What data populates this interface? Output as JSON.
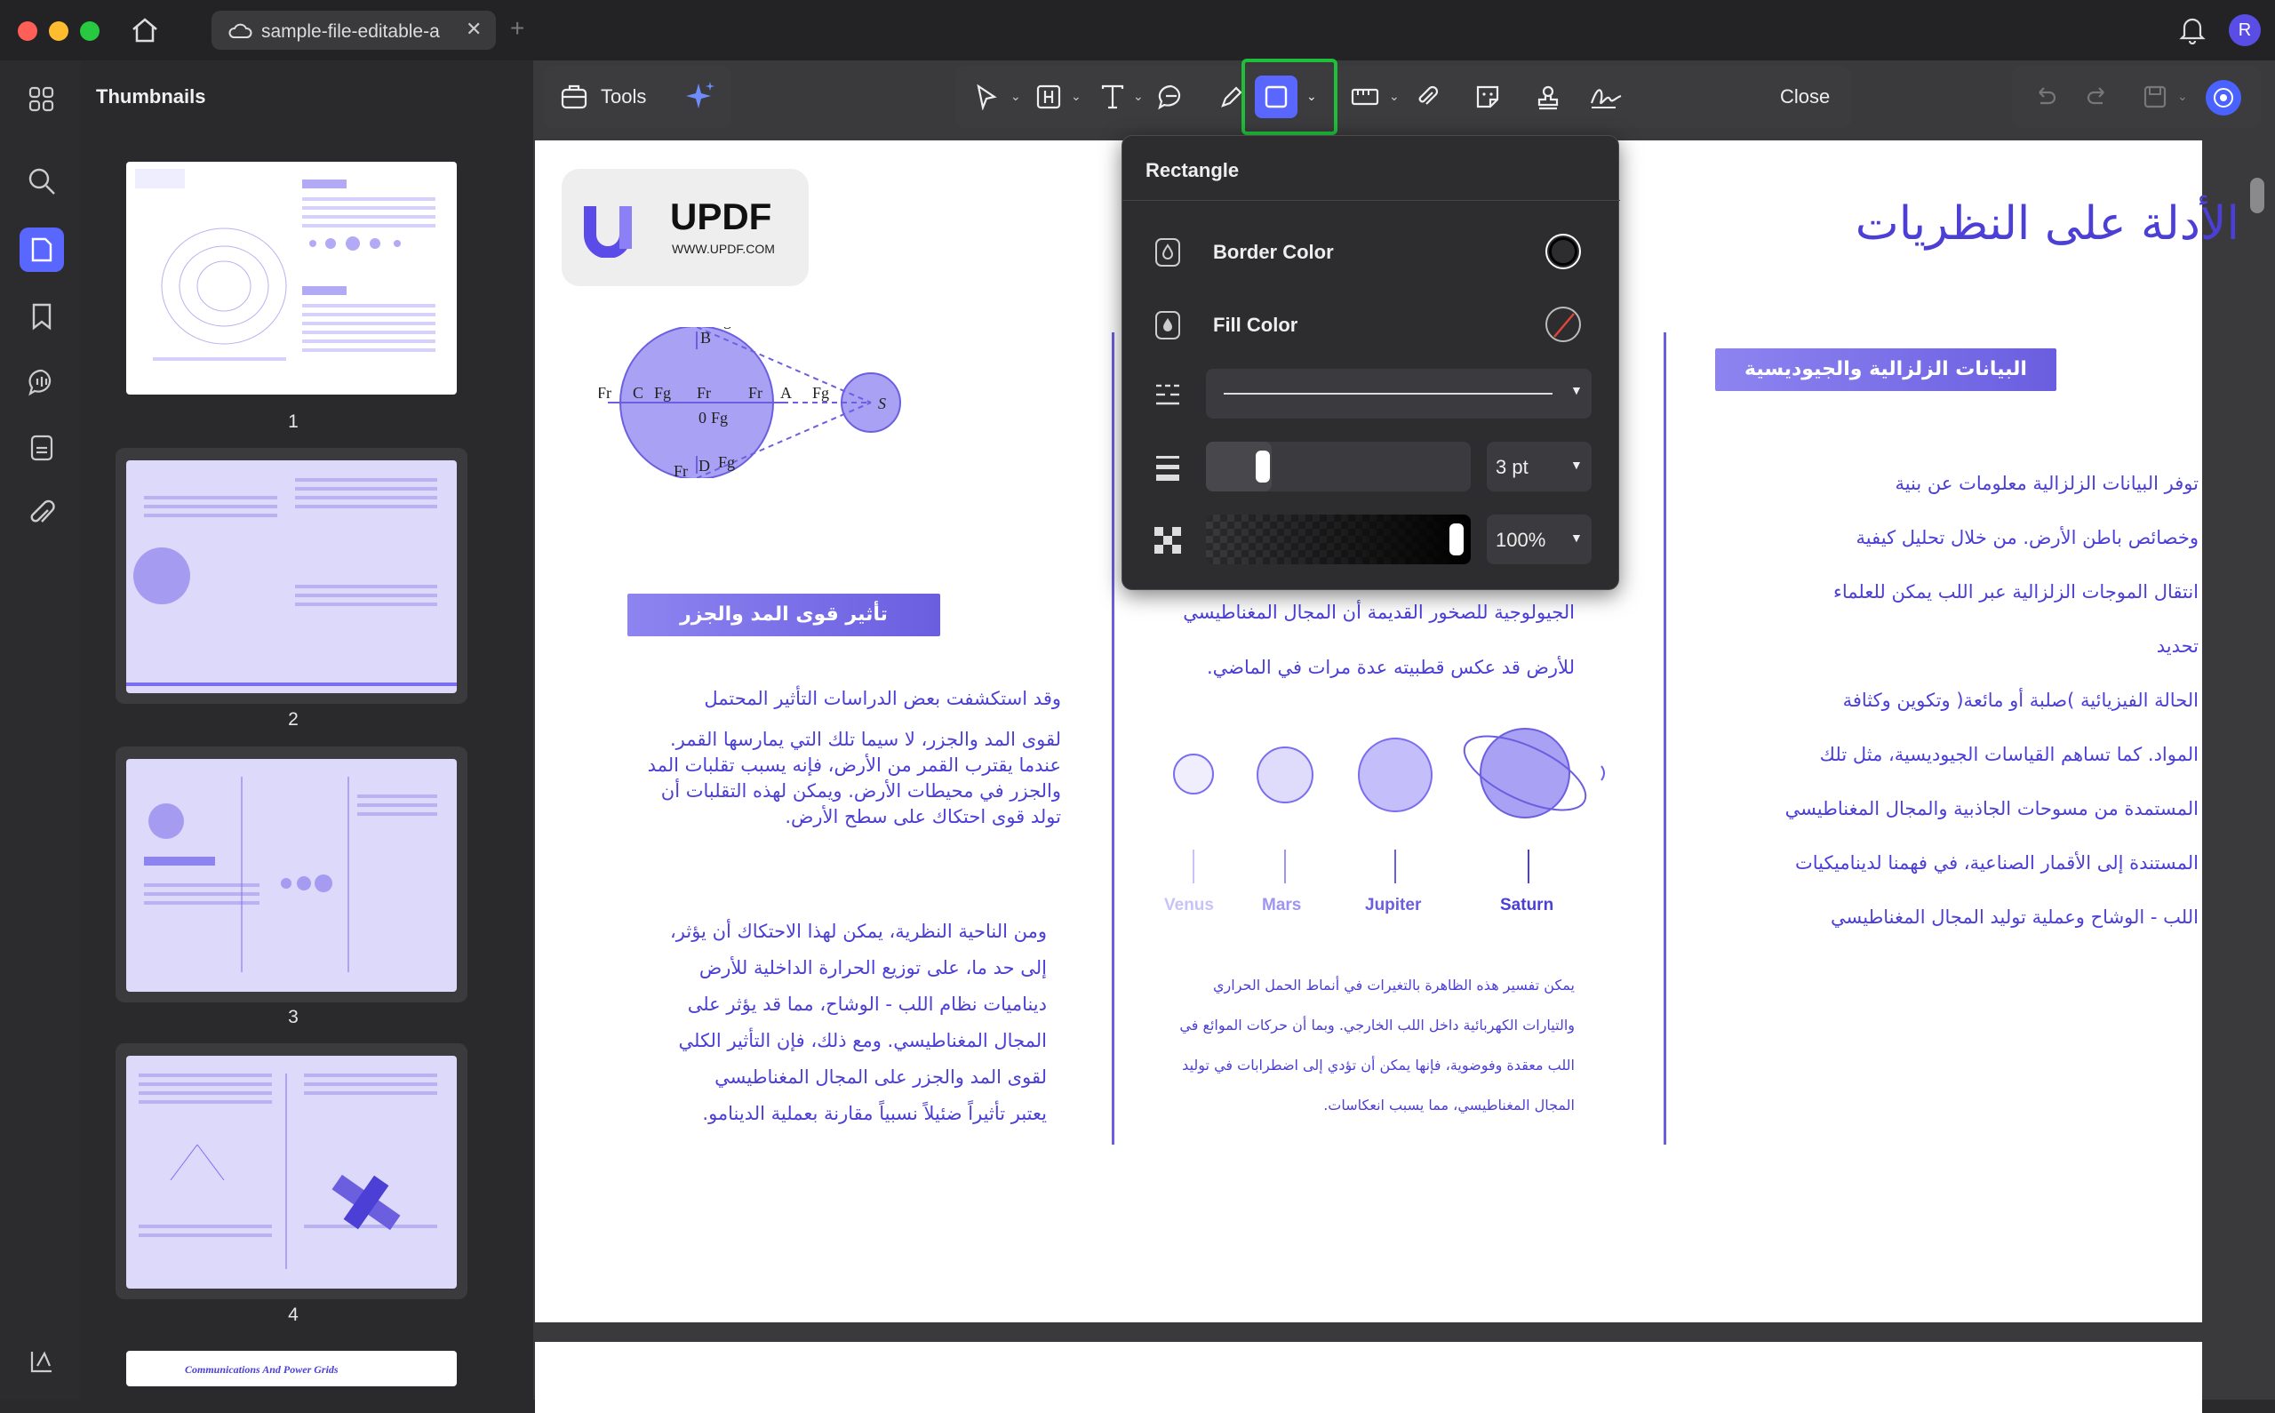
{
  "window": {
    "tab_title": "sample-file-editable-a",
    "user_initial": "R"
  },
  "colors": {
    "accent": "#5a67ff",
    "highlight_border": "#1fbf3a",
    "doc_purple": "#4b3fd6"
  },
  "sidebar": {
    "title": "Thumbnails",
    "pages": [
      "1",
      "2",
      "3",
      "4"
    ],
    "page5_title": "Communications And Power Grids"
  },
  "toolbar": {
    "tools_label": "Tools",
    "close_label": "Close"
  },
  "rectangle_panel": {
    "title": "Rectangle",
    "border_color_label": "Border Color",
    "fill_color_label": "Fill Color",
    "stroke_width": "3 pt",
    "opacity": "100%"
  },
  "doc": {
    "logo_text": "UPDF",
    "logo_url": "WWW.UPDF.COM",
    "main_title": "الأدلة على النظريات",
    "right_heading": "البيانات الزلزالية والجيوديسية",
    "right_lines": [
      "توفر البيانات الزلزالية معلومات عن بنية",
      "وخصائص باطن الأرض. من خلال تحليل كيفية",
      "انتقال الموجات الزلزالية عبر اللب يمكن للعلماء",
      "تحديد",
      "الحالة الفيزيائية )صلبة أو مائعة( وتكوين وكثافة",
      "المواد. كما تساهم القياسات الجيوديسية، مثل تلك",
      "المستمدة من مسوحات الجاذبية والمجال المغناطيسي",
      "المستندة إلى الأقمار الصناعية، في فهمنا لديناميكيات",
      "اللب - الوشاح وعملية توليد المجال المغناطيسي"
    ],
    "middle_lines": [
      "الجيولوجية للصخور القديمة أن المجال المغناطيسي",
      "للأرض قد عكس قطبيته عدة مرات في الماضي."
    ],
    "planets": [
      "Venus",
      "Mars",
      "Jupiter",
      "Saturn"
    ],
    "middle_small": [
      "يمكن تفسير هذه الظاهرة بالتغيرات في أنماط الحمل الحراري",
      "والتيارات الكهربائية داخل اللب الخارجي. وبما أن حركات الموائع في",
      "اللب معقدة وفوضوية، فإنها يمكن أن تؤدي إلى اضطرابات في توليد",
      "المجال المغناطيسي، مما يسبب انعكاسات."
    ],
    "left_heading": "تأثير قوى المد والجزر",
    "left_para1": [
      "وقد استكشفت بعض الدراسات التأثير المحتمل",
      "لقوى المد والجزر، لا سيما تلك التي يمارسها القمر.",
      "عندما يقترب القمر من الأرض، فإنه يسبب تقلبات المد",
      "والجزر في محيطات الأرض. ويمكن لهذه التقلبات أن",
      "تولد قوى احتكاك على سطح الأرض."
    ],
    "left_para2": [
      "ومن الناحية النظرية، يمكن لهذا الاحتكاك أن يؤثر،",
      "إلى حد ما، على توزيع الحرارة الداخلية للأرض",
      "ديناميات نظام اللب - الوشاح، مما قد يؤثر على",
      "المجال المغناطيسي. ومع ذلك، فإن التأثير الكلي",
      "لقوى المد والجزر على المجال المغناطيسي",
      "يعتبر تأثيراً ضئيلاً نسبياً مقارنة بعملية الدينامو."
    ],
    "diagram_labels": {
      "fr": "Fr",
      "fg": "Fg",
      "b": "B",
      "c": "C",
      "a": "A",
      "d": "D",
      "zero": "0",
      "s": "S"
    }
  }
}
